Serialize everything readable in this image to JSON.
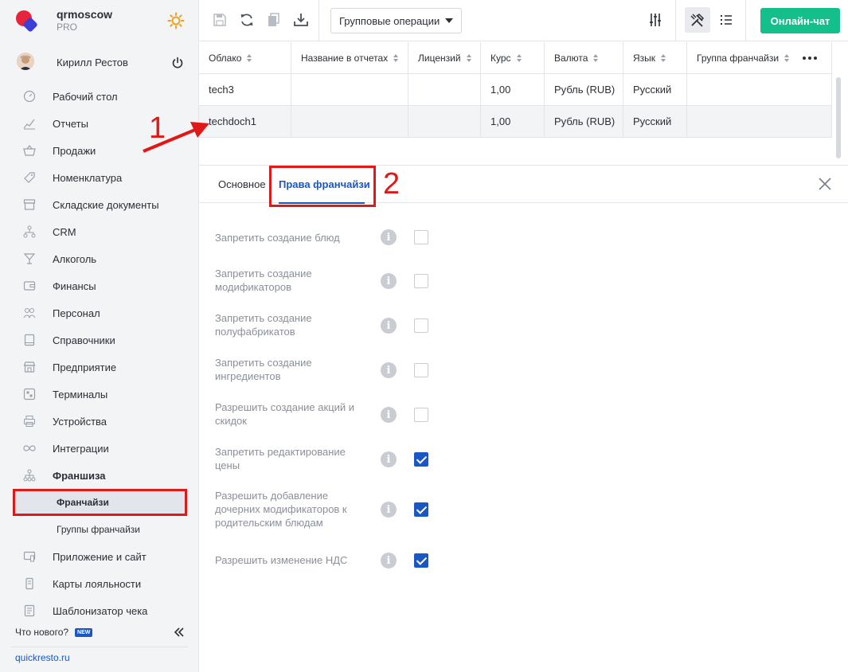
{
  "brand": {
    "name": "qrmoscow",
    "plan": "PRO"
  },
  "user": {
    "name": "Кирилл Рестов"
  },
  "sidebar": {
    "items": [
      {
        "label": "Рабочий стол",
        "icon": "dashboard-icon"
      },
      {
        "label": "Отчеты",
        "icon": "chart-icon"
      },
      {
        "label": "Продажи",
        "icon": "basket-icon"
      },
      {
        "label": "Номенклатура",
        "icon": "tag-icon"
      },
      {
        "label": "Складские документы",
        "icon": "archive-icon"
      },
      {
        "label": "CRM",
        "icon": "crm-icon"
      },
      {
        "label": "Алкоголь",
        "icon": "glass-icon"
      },
      {
        "label": "Финансы",
        "icon": "wallet-icon"
      },
      {
        "label": "Персонал",
        "icon": "people-icon"
      },
      {
        "label": "Справочники",
        "icon": "book-icon"
      },
      {
        "label": "Предприятие",
        "icon": "store-icon"
      },
      {
        "label": "Терминалы",
        "icon": "qr-icon"
      },
      {
        "label": "Устройства",
        "icon": "printer-icon"
      },
      {
        "label": "Интеграции",
        "icon": "infinity-icon"
      },
      {
        "label": "Франшиза",
        "icon": "hierarchy-icon"
      }
    ],
    "sub_items": [
      {
        "label": "Франчайзи"
      },
      {
        "label": "Группы франчайзи"
      }
    ],
    "items_after": [
      {
        "label": "Приложение и сайт",
        "icon": "app-icon"
      },
      {
        "label": "Карты лояльности",
        "icon": "card-icon"
      },
      {
        "label": "Шаблонизатор чека",
        "icon": "receipt-icon"
      }
    ],
    "whats_new": "Что нового?",
    "new_badge": "NEW",
    "site": "quickresto.ru"
  },
  "toolbar": {
    "group_ops": "Групповые операции",
    "chat": "Онлайн-чат"
  },
  "table": {
    "columns": [
      "Облако",
      "Название в отчетах",
      "Лицензий",
      "Курс",
      "Валюта",
      "Язык",
      "Группа франчайзи"
    ],
    "rows": [
      [
        "tech3",
        "",
        "",
        "1,00",
        "Рубль (RUB)",
        "Русский",
        ""
      ],
      [
        "techdoch1",
        "",
        "",
        "1,00",
        "Рубль (RUB)",
        "Русский",
        ""
      ]
    ]
  },
  "tabs": {
    "main": "Основное",
    "rights": "Права франчайзи"
  },
  "permissions": [
    {
      "text": "Запретить создание блюд",
      "checked": false
    },
    {
      "text": "Запретить создание модификаторов",
      "checked": false
    },
    {
      "text": "Запретить создание полуфабрикатов",
      "checked": false
    },
    {
      "text": "Запретить создание ингредиентов",
      "checked": false
    },
    {
      "text": "Разрешить создание акций и скидок",
      "checked": false
    },
    {
      "text": "Запретить редактирование цены",
      "checked": true
    },
    {
      "text": "Разрешить добавление дочерних модификаторов к родительским блюдам",
      "checked": true
    },
    {
      "text": "Разрешить изменение НДС",
      "checked": true
    }
  ],
  "annotations": {
    "step1": "1",
    "step2": "2"
  },
  "colors": {
    "accent": "#1a56c4",
    "chat": "#13bf8a",
    "annotation": "#e01818"
  }
}
